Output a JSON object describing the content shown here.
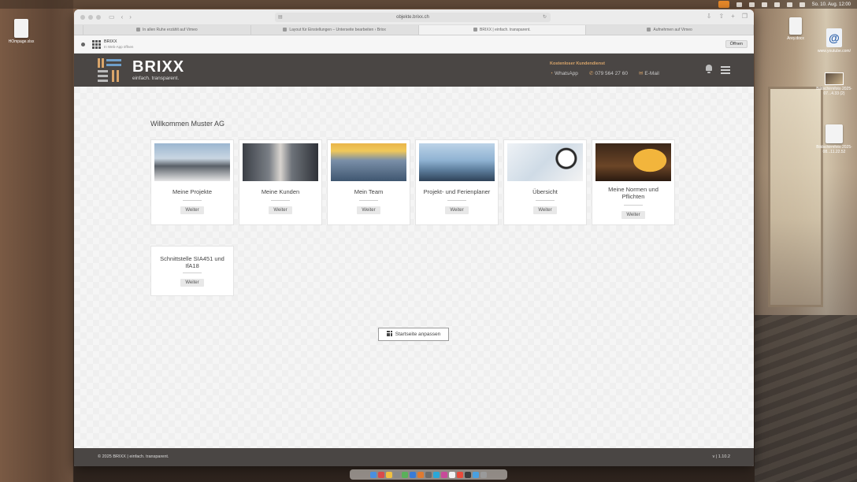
{
  "colors": {
    "header_bg": "#4a4644",
    "accent": "#d9a56a",
    "content_bg": "#efefef"
  },
  "menubar": {
    "datetime": "So. 10. Aug. 12:00"
  },
  "desktop_icons": [
    {
      "label": "HOmpage.xlsx",
      "icon": "spreadsheet-file-icon"
    },
    {
      "label": "Arey.docx",
      "icon": "document-file-icon"
    },
    {
      "label": "www.youtube.com/",
      "icon": "web-location-icon"
    },
    {
      "label": "Bildschirmfoto 2025-07...4.33 (2)",
      "icon": "screenshot-file-icon"
    },
    {
      "label": "Bildschirmfoto 2025-08...11.22.52",
      "icon": "screenshot-file-icon"
    }
  ],
  "browser": {
    "url": "objekte.brixx.ch",
    "tabs": [
      {
        "label": "In allen Ruhe erzählt auf Vimeo"
      },
      {
        "label": "Layout für Einstellungen – Unterseite bearbeiten ‹ Brixx"
      },
      {
        "label": "BRIXX | einfach. transparent.",
        "active": true
      },
      {
        "label": "Aufnehmen auf Vimeo"
      }
    ],
    "webapp": {
      "name": "BRIXX",
      "sub": "In Web-App öffnen",
      "open_label": "Öffnen"
    }
  },
  "header": {
    "brand_title": "BRIXX",
    "brand_tagline": "einfach. transparent.",
    "service_title": "Kostenloser Kundendienst",
    "whatsapp": "WhatsApp",
    "phone": "079 564 27 60",
    "email": "E-Mail"
  },
  "main": {
    "welcome": "Willkommen Muster AG",
    "tiles": [
      {
        "label": "Meine Projekte",
        "button": "Weiter",
        "image": "architects-photo"
      },
      {
        "label": "Meine Kunden",
        "button": "Weiter",
        "image": "handshake-photo"
      },
      {
        "label": "Mein Team",
        "button": "Weiter",
        "image": "team-photo"
      },
      {
        "label": "Projekt- und Ferienplaner",
        "button": "Weiter",
        "image": "planner-photo"
      },
      {
        "label": "Übersicht",
        "button": "Weiter",
        "image": "charts-photo"
      },
      {
        "label": "Meine Normen und Pflichten",
        "button": "Weiter",
        "image": "gavel-helmet-photo"
      },
      {
        "label": "Schnittstelle SIA451 und IfA18",
        "button": "Weiter"
      }
    ],
    "customize_label": "Startseite anpassen"
  },
  "footer": {
    "copyright": "© 2025 BRIXX | einfach. transparent.",
    "version": "v | 1.10.2"
  }
}
